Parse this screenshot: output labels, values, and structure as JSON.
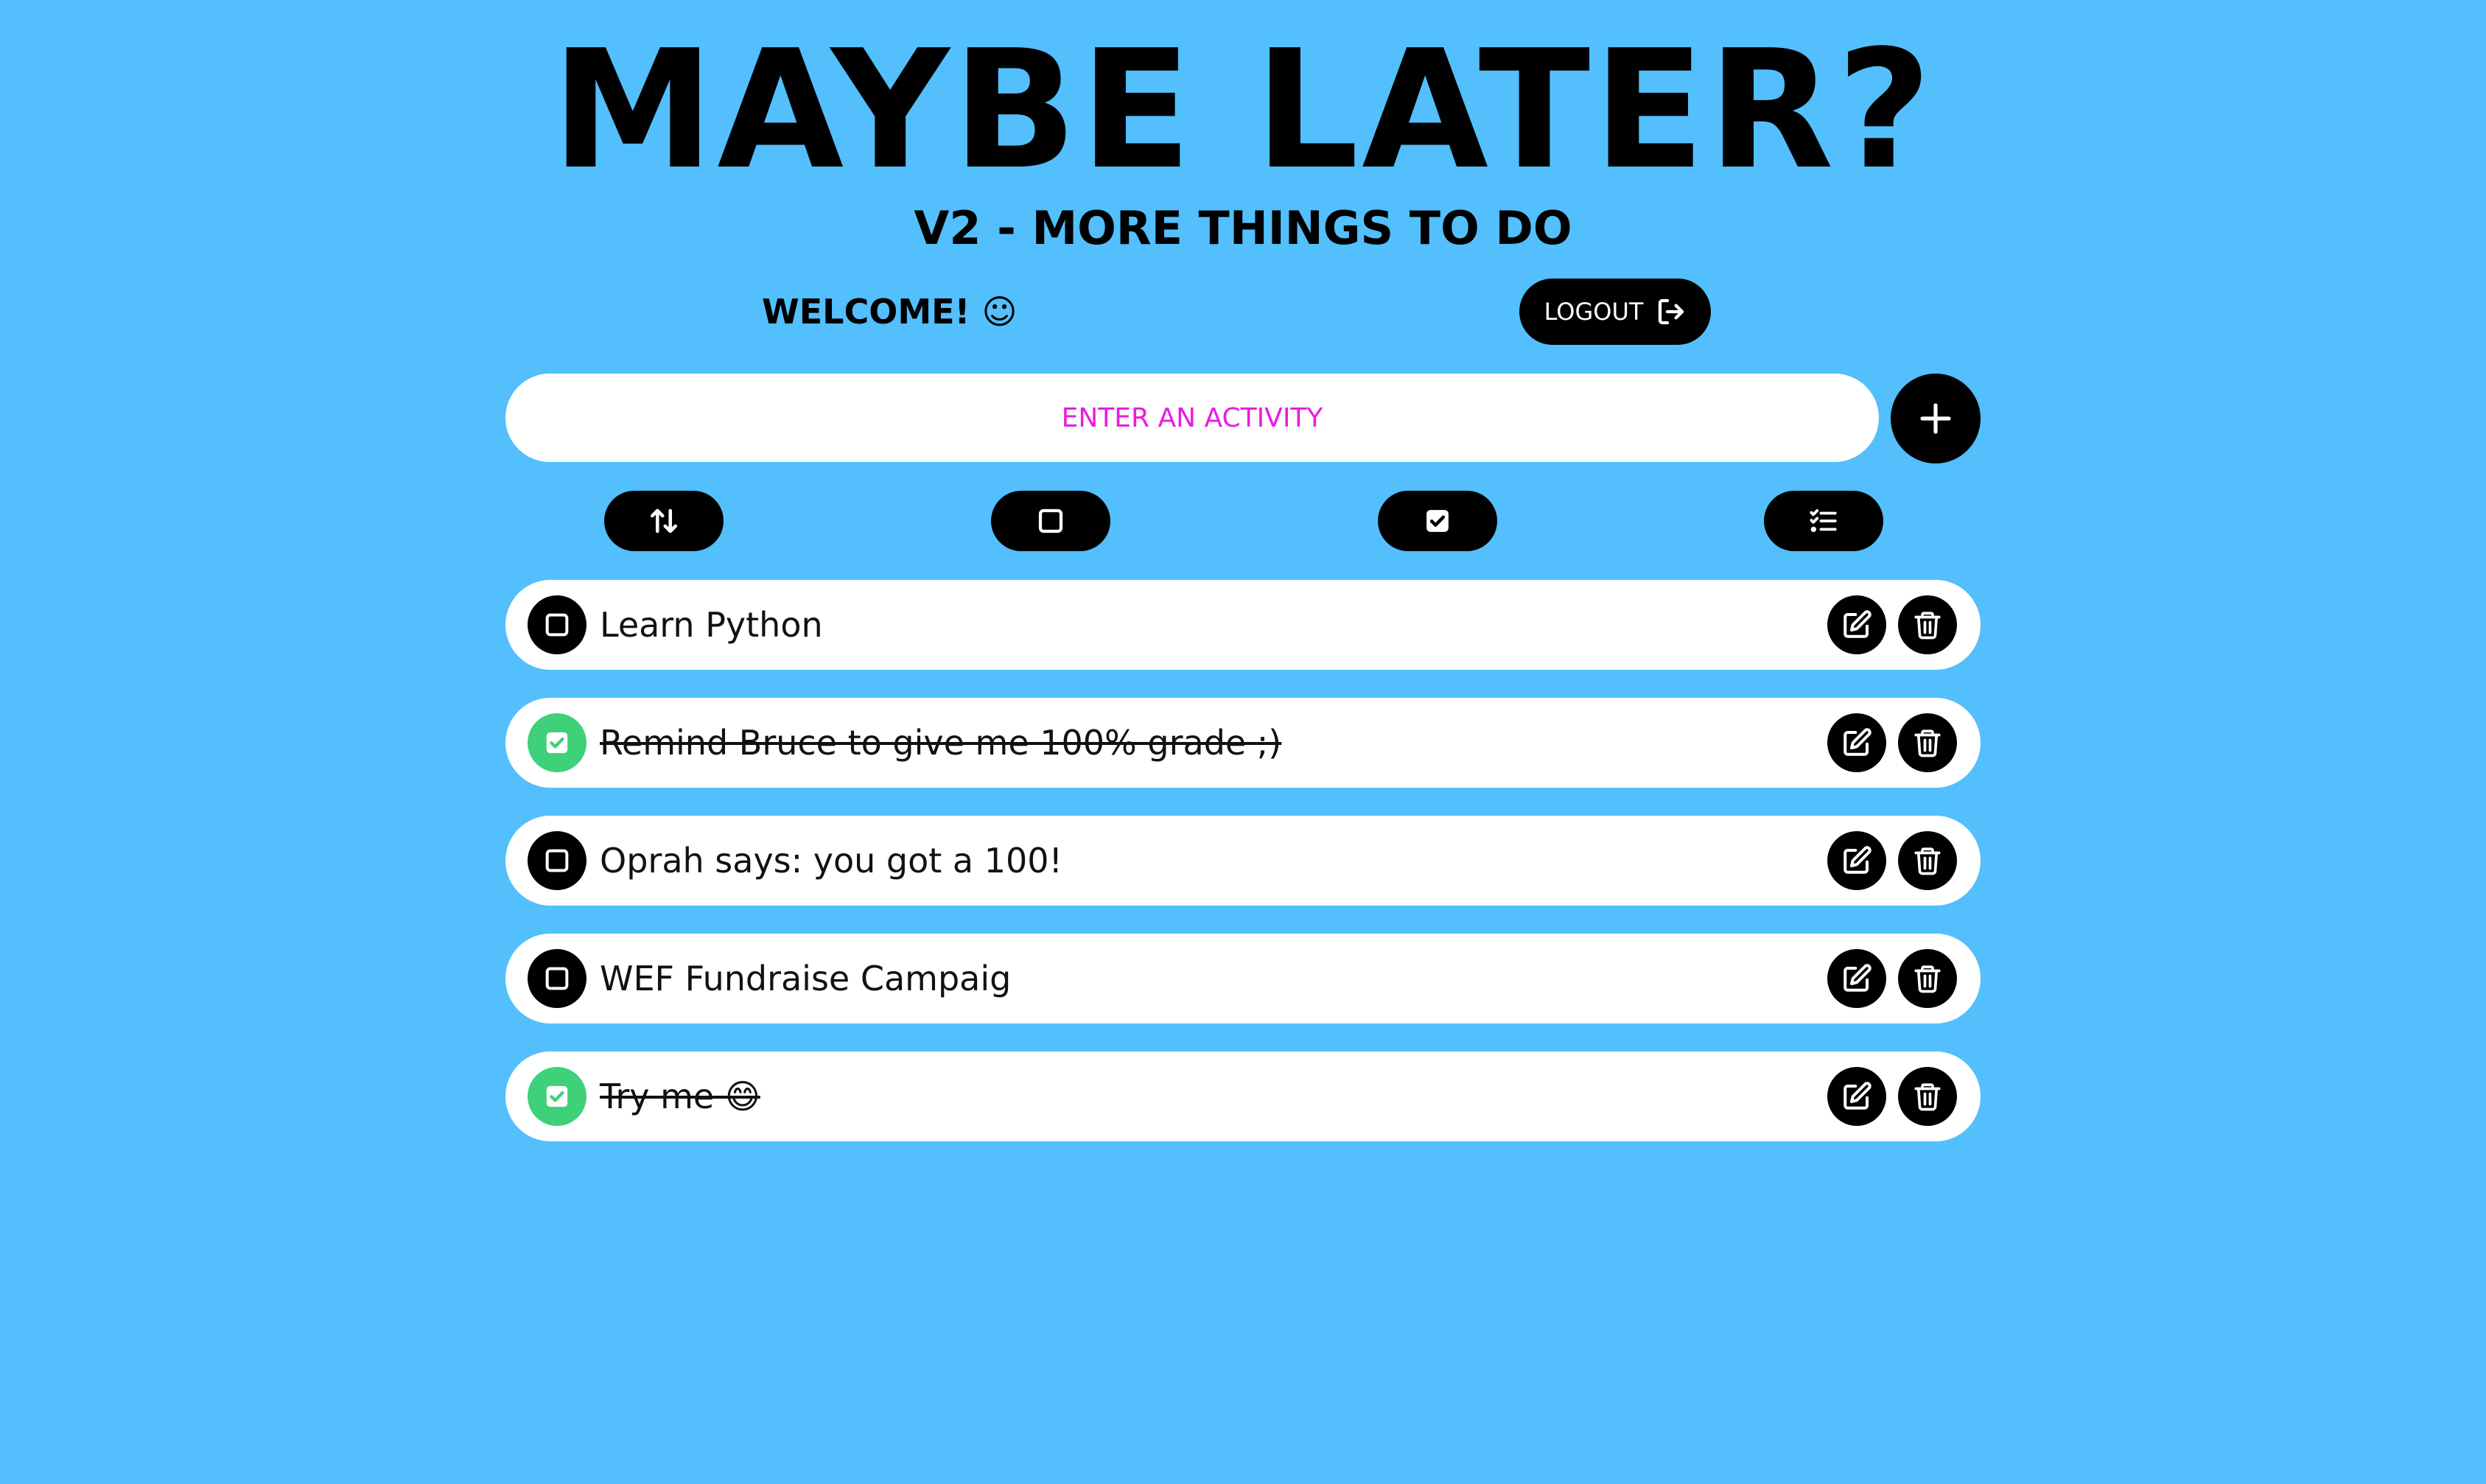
{
  "header": {
    "title": "MAYBE LATER?",
    "subtitle": "V2 - MORE THINGS TO DO"
  },
  "user": {
    "welcome": "WELCOME! ☺",
    "logout_label": "LOGOUT",
    "logout_icon": "logout-icon"
  },
  "input": {
    "placeholder": "ENTER AN ACTIVITY",
    "value": "",
    "add_icon": "plus-icon"
  },
  "filters": [
    {
      "name": "sort",
      "icon": "sort-arrows-icon"
    },
    {
      "name": "pending",
      "icon": "empty-square-icon"
    },
    {
      "name": "completed",
      "icon": "checked-square-icon"
    },
    {
      "name": "all",
      "icon": "checklist-icon"
    }
  ],
  "tasks": [
    {
      "text": "Learn Python",
      "done": false
    },
    {
      "text": "Remind Bruce to give me 100% grade ;)",
      "done": true
    },
    {
      "text": "Oprah says: you got a 100!",
      "done": false
    },
    {
      "text": "WEF Fundraise Campaig",
      "done": false
    },
    {
      "text": "Try me 😄",
      "done": true
    }
  ],
  "colors": {
    "background": "#53bffc",
    "done_check": "#3fd07a",
    "placeholder": "#e81ce0",
    "button": "#000000"
  }
}
